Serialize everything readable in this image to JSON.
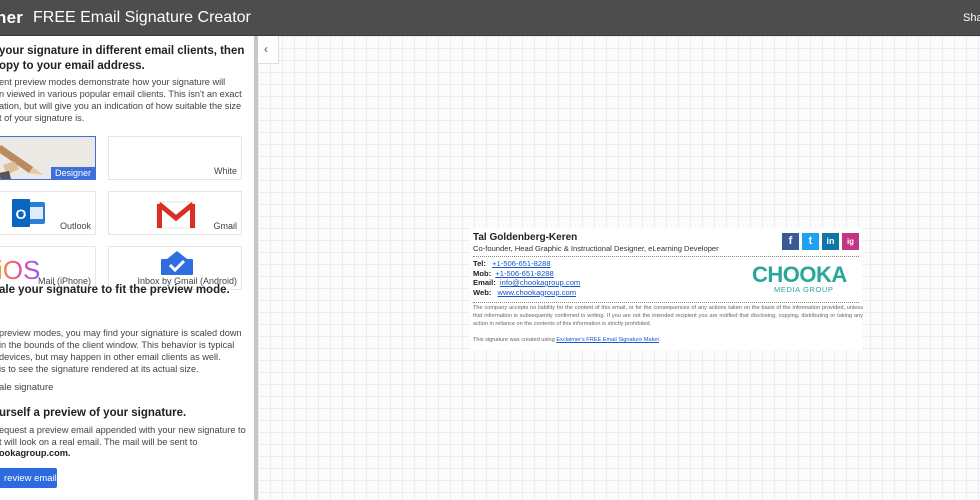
{
  "header": {
    "brand": "ner",
    "title": "FREE Email Signature Creator",
    "share": "Sha"
  },
  "sidebar": {
    "section1": {
      "heading_line1": "your signature in different email clients, then",
      "heading_line2": "opy to your email address.",
      "body": [
        "ent preview modes demonstrate how your signature will",
        "n viewed in various popular email clients. This isn't an exact",
        "ation, but will give you an indication of how suitable the size",
        "t of your signature is."
      ]
    },
    "modes": [
      {
        "label": "Designer",
        "selected": true
      },
      {
        "label": "White",
        "selected": false
      },
      {
        "label": "Outlook",
        "selected": false
      },
      {
        "label": "Gmail",
        "selected": false
      },
      {
        "label": "Mail (iPhone)",
        "selected": false
      },
      {
        "label": "Inbox by Gmail (Android)",
        "selected": false
      }
    ],
    "section2": {
      "heading": "ale your signature to fit the preview mode.",
      "body": [
        "preview modes, you may find your signature is scaled down",
        "in the bounds of the client window. This behavior is typical",
        "devices, but may happen in other email clients as well.",
        "is to see the signature rendered at its actual size."
      ],
      "option": "ale signature"
    },
    "section3": {
      "heading": "urself a preview of your signature.",
      "body": [
        "equest a preview email appended with your new signature to",
        "t will look on a real email. The mail will be sent to"
      ],
      "email": "ookagroup.com.",
      "button": "review email"
    },
    "icons": {
      "outlook_glyph": "O",
      "ios_glyph": "iOS"
    }
  },
  "canvas": {
    "collapse_glyph": "‹"
  },
  "signature": {
    "name": "Tal Goldenberg-Keren",
    "role": "Co-founder, Head Graphic & Instructional Designer, eLearning Developer",
    "tel_label": "Tel:",
    "tel": "+1-506-651-8288",
    "mob_label": "Mob:",
    "mob": "+1-506-651-8288",
    "email_label": "Email:",
    "email": "info@chookagroup.com",
    "web_label": "Web:",
    "web": "www.chookagroup.com",
    "logo_main": "CHOOKA",
    "logo_sub": "MEDIA GROUP",
    "social": [
      "f",
      "t",
      "in",
      "ig"
    ],
    "disclaimer": "The company accepts no liability for the content of this email, or for the consequences of any actions taken on the basis of the information provided, unless that information is subsequently confirmed in writing. If you are not the intended recipient you are notified that disclosing, copying, distributing or taking any action in reliance on the contents of this information is strictly prohibited.",
    "created_prefix": "This signature was created using ",
    "created_link": "Exclaimer's FREE Email Signature Maker",
    "created_suffix": "."
  },
  "colors": {
    "topbar": "#4d4d4d",
    "accent": "#3f6fd8",
    "button": "#2c6ae0",
    "link": "#1a55c9",
    "facebook": "#3b5998",
    "twitter": "#1da1f2",
    "linkedin": "#0e76a8",
    "instagram": "#c13584",
    "chooka_teal": "#2aa79b",
    "gmail_red": "#d93025"
  }
}
